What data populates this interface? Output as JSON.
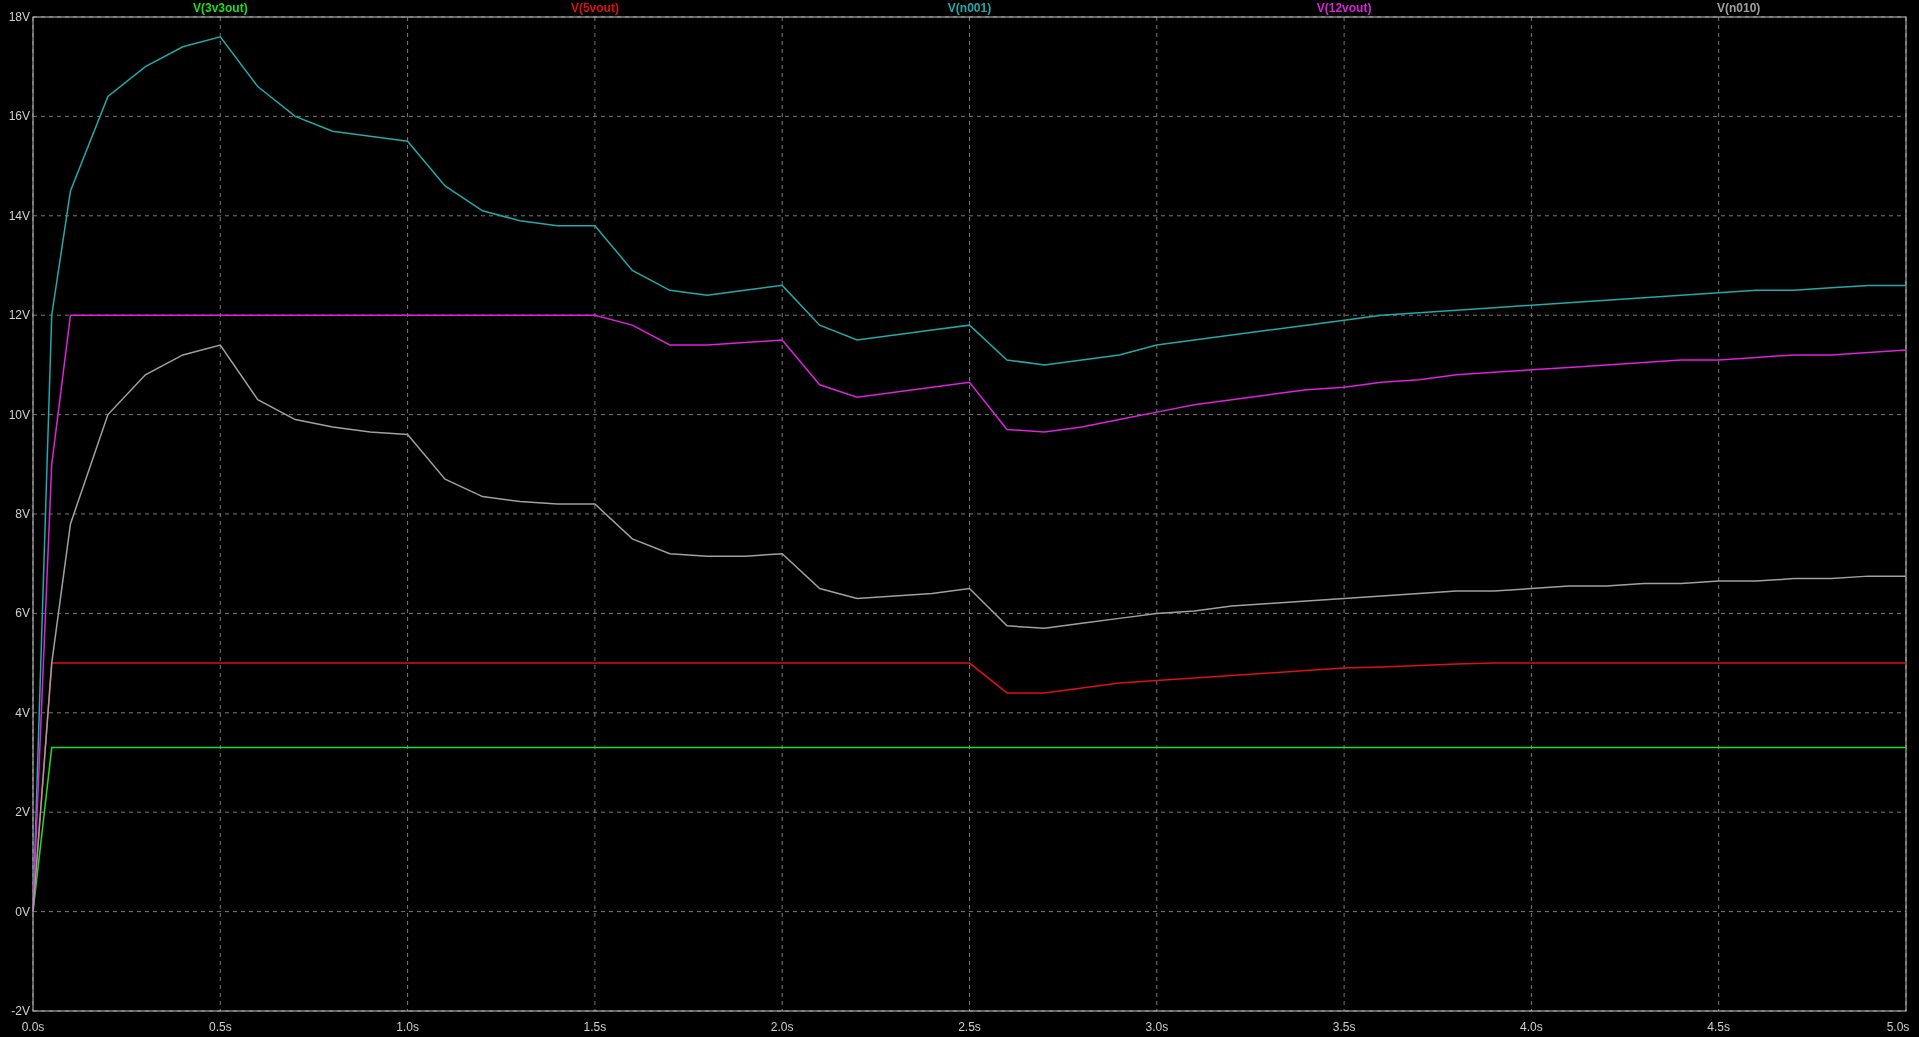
{
  "plot": {
    "chart_data": {
      "type": "line",
      "grid": true,
      "x": [
        0,
        0.05,
        0.1,
        0.2,
        0.3,
        0.4,
        0.5,
        0.6,
        0.7,
        0.8,
        0.9,
        1.0,
        1.1,
        1.2,
        1.3,
        1.4,
        1.5,
        1.6,
        1.7,
        1.8,
        1.9,
        2.0,
        2.1,
        2.2,
        2.3,
        2.4,
        2.5,
        2.6,
        2.7,
        2.8,
        2.9,
        3.0,
        3.1,
        3.2,
        3.3,
        3.4,
        3.5,
        3.6,
        3.7,
        3.8,
        3.9,
        4.0,
        4.1,
        4.2,
        4.3,
        4.4,
        4.5,
        4.6,
        4.7,
        4.8,
        4.9,
        5.0
      ],
      "series": [
        {
          "name": "V(3v3out)",
          "color": "#22dd22",
          "values": [
            0,
            3.3,
            3.3,
            3.3,
            3.3,
            3.3,
            3.3,
            3.3,
            3.3,
            3.3,
            3.3,
            3.3,
            3.3,
            3.3,
            3.3,
            3.3,
            3.3,
            3.3,
            3.3,
            3.3,
            3.3,
            3.3,
            3.3,
            3.3,
            3.3,
            3.3,
            3.3,
            3.3,
            3.3,
            3.3,
            3.3,
            3.3,
            3.3,
            3.3,
            3.3,
            3.3,
            3.3,
            3.3,
            3.3,
            3.3,
            3.3,
            3.3,
            3.3,
            3.3,
            3.3,
            3.3,
            3.3,
            3.3,
            3.3,
            3.3,
            3.3,
            3.3
          ]
        },
        {
          "name": "V(5vout)",
          "color": "#dd1111",
          "values": [
            0,
            5,
            5,
            5,
            5,
            5,
            5,
            5,
            5,
            5,
            5,
            5,
            5,
            5,
            5,
            5,
            5,
            5,
            5,
            5,
            5,
            5,
            5,
            5,
            5,
            5,
            5,
            4.4,
            4.4,
            4.5,
            4.6,
            4.65,
            4.7,
            4.75,
            4.8,
            4.85,
            4.9,
            4.92,
            4.95,
            4.98,
            5,
            5,
            5,
            5,
            5,
            5,
            5,
            5,
            5,
            5,
            5,
            5
          ]
        },
        {
          "name": "V(n001)",
          "color": "#22aaaa",
          "values": [
            0,
            12,
            14.5,
            16.4,
            17,
            17.4,
            17.6,
            16.6,
            16,
            15.7,
            15.6,
            15.5,
            14.6,
            14.1,
            13.9,
            13.8,
            13.8,
            12.9,
            12.5,
            12.4,
            12.5,
            12.6,
            11.8,
            11.5,
            11.6,
            11.7,
            11.8,
            11.1,
            11,
            11.1,
            11.2,
            11.4,
            11.5,
            11.6,
            11.7,
            11.8,
            11.9,
            12,
            12.05,
            12.1,
            12.15,
            12.2,
            12.25,
            12.3,
            12.35,
            12.4,
            12.45,
            12.5,
            12.5,
            12.55,
            12.6,
            12.6
          ]
        },
        {
          "name": "V(12vout)",
          "color": "#dd22dd",
          "values": [
            0,
            9,
            12,
            12,
            12,
            12,
            12,
            12,
            12,
            12,
            12,
            12,
            12,
            12,
            12,
            12,
            12,
            11.8,
            11.4,
            11.4,
            11.45,
            11.5,
            10.6,
            10.35,
            10.45,
            10.55,
            10.65,
            9.7,
            9.65,
            9.75,
            9.9,
            10.05,
            10.2,
            10.3,
            10.4,
            10.5,
            10.55,
            10.65,
            10.7,
            10.8,
            10.85,
            10.9,
            10.95,
            11,
            11.05,
            11.1,
            11.1,
            11.15,
            11.2,
            11.2,
            11.25,
            11.3
          ]
        },
        {
          "name": "V(n010)",
          "color": "#a0a0a0",
          "values": [
            0,
            5,
            7.8,
            10,
            10.8,
            11.2,
            11.4,
            10.3,
            9.9,
            9.75,
            9.65,
            9.6,
            8.7,
            8.35,
            8.25,
            8.2,
            8.2,
            7.5,
            7.2,
            7.15,
            7.15,
            7.2,
            6.5,
            6.3,
            6.35,
            6.4,
            6.5,
            5.75,
            5.7,
            5.8,
            5.9,
            6,
            6.05,
            6.15,
            6.2,
            6.25,
            6.3,
            6.35,
            6.4,
            6.45,
            6.45,
            6.5,
            6.55,
            6.55,
            6.6,
            6.6,
            6.65,
            6.65,
            6.7,
            6.7,
            6.75,
            6.75
          ]
        }
      ],
      "xlim": [
        0,
        5
      ],
      "ylim": [
        -2,
        18
      ],
      "xticks": [
        {
          "value": 0,
          "label": "0.0s"
        },
        {
          "value": 0.5,
          "label": "0.5s"
        },
        {
          "value": 1,
          "label": "1.0s"
        },
        {
          "value": 1.5,
          "label": "1.5s"
        },
        {
          "value": 2,
          "label": "2.0s"
        },
        {
          "value": 2.5,
          "label": "2.5s"
        },
        {
          "value": 3,
          "label": "3.0s"
        },
        {
          "value": 3.5,
          "label": "3.5s"
        },
        {
          "value": 4,
          "label": "4.0s"
        },
        {
          "value": 4.5,
          "label": "4.5s"
        },
        {
          "value": 5,
          "label": "5.0s"
        }
      ],
      "yticks": [
        {
          "value": -2,
          "label": "-2V"
        },
        {
          "value": 0,
          "label": "0V"
        },
        {
          "value": 2,
          "label": "2V"
        },
        {
          "value": 4,
          "label": "4V"
        },
        {
          "value": 6,
          "label": "6V"
        },
        {
          "value": 8,
          "label": "8V"
        },
        {
          "value": 10,
          "label": "10V"
        },
        {
          "value": 12,
          "label": "12V"
        },
        {
          "value": 14,
          "label": "14V"
        },
        {
          "value": 16,
          "label": "16V"
        },
        {
          "value": 18,
          "label": "18V"
        }
      ]
    }
  }
}
